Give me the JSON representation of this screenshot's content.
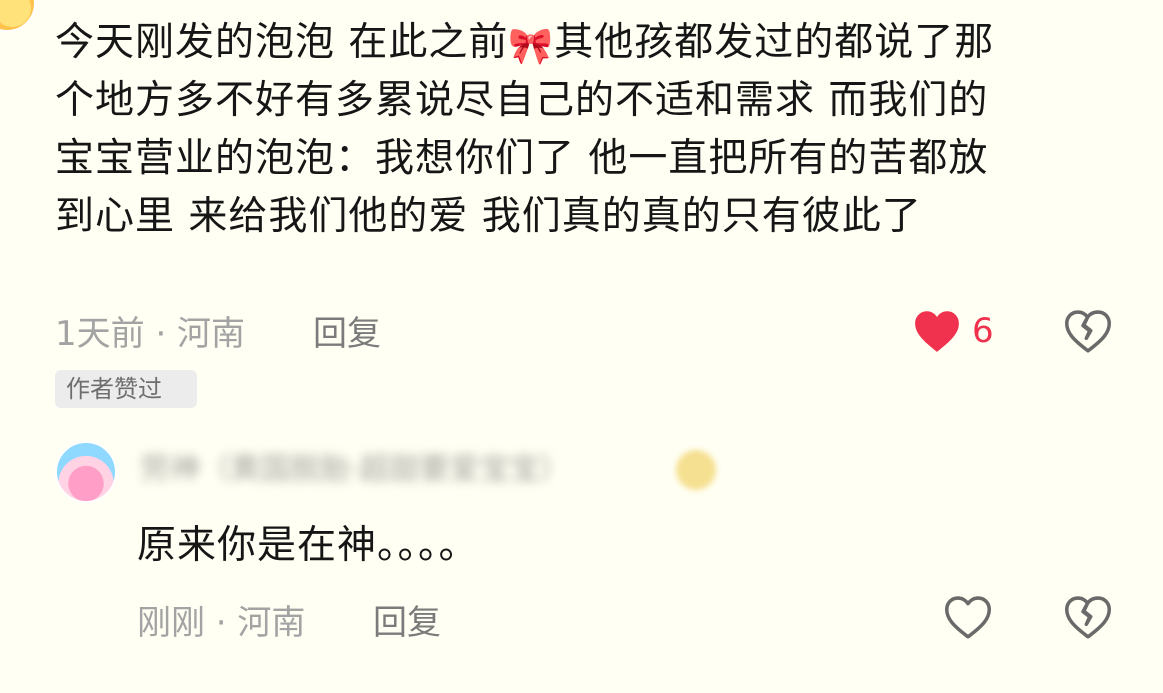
{
  "comment": {
    "line1_pre": "今天刚发的泡泡 在此之前",
    "bow_emoji": "🎀",
    "line1_post": "其他孩都发过的都说了那",
    "line2": "个地方多不好有多累说尽自己的不适和需求 而我们的",
    "line3": "宝宝营业的泡泡：我想你们了 他一直把所有的苦都放",
    "line4": "到心里 来给我们他的爱 我们真的真的只有彼此了",
    "time_location": "1天前 · 河南",
    "reply_label": "回复",
    "like_count": "6",
    "liked": true,
    "author_liked_badge": "作者赞过",
    "icons": {
      "like": "heart-filled-icon",
      "dislike": "broken-heart-icon"
    },
    "accent_color": "#f0324e"
  },
  "reply": {
    "username": "劳神（黄国脱胎·超甜要爱宝宝）",
    "text": "原来你是在神。。。。",
    "time_location": "刚刚 · 河南",
    "reply_label": "回复",
    "liked": false,
    "icons": {
      "like": "heart-outline-icon",
      "dislike": "broken-heart-icon"
    }
  }
}
